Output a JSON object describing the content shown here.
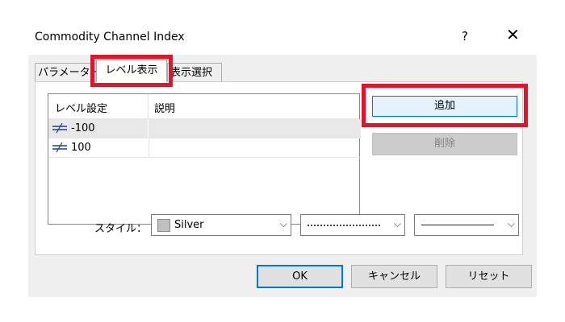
{
  "dialog": {
    "title": "Commodity Channel Index",
    "help": "?",
    "close": "✕"
  },
  "tabs": [
    {
      "label": "パラメーター"
    },
    {
      "label": "レベル表示"
    },
    {
      "label": "表示選択"
    }
  ],
  "levels": {
    "header_level": "レベル設定",
    "header_desc": "説明",
    "rows": [
      {
        "value": "-100",
        "description": ""
      },
      {
        "value": "100",
        "description": ""
      }
    ]
  },
  "buttons": {
    "add": "追加",
    "delete": "削除",
    "ok": "OK",
    "cancel": "キャンセル",
    "reset": "リセット"
  },
  "style": {
    "label": "スタイル：",
    "color_name": "Silver",
    "color_value": "#c0c0c0",
    "line_style": "dotted",
    "line_width": "thin"
  },
  "colors": {
    "highlight_red": "#e3132c",
    "accent_blue": "#0078d7"
  }
}
